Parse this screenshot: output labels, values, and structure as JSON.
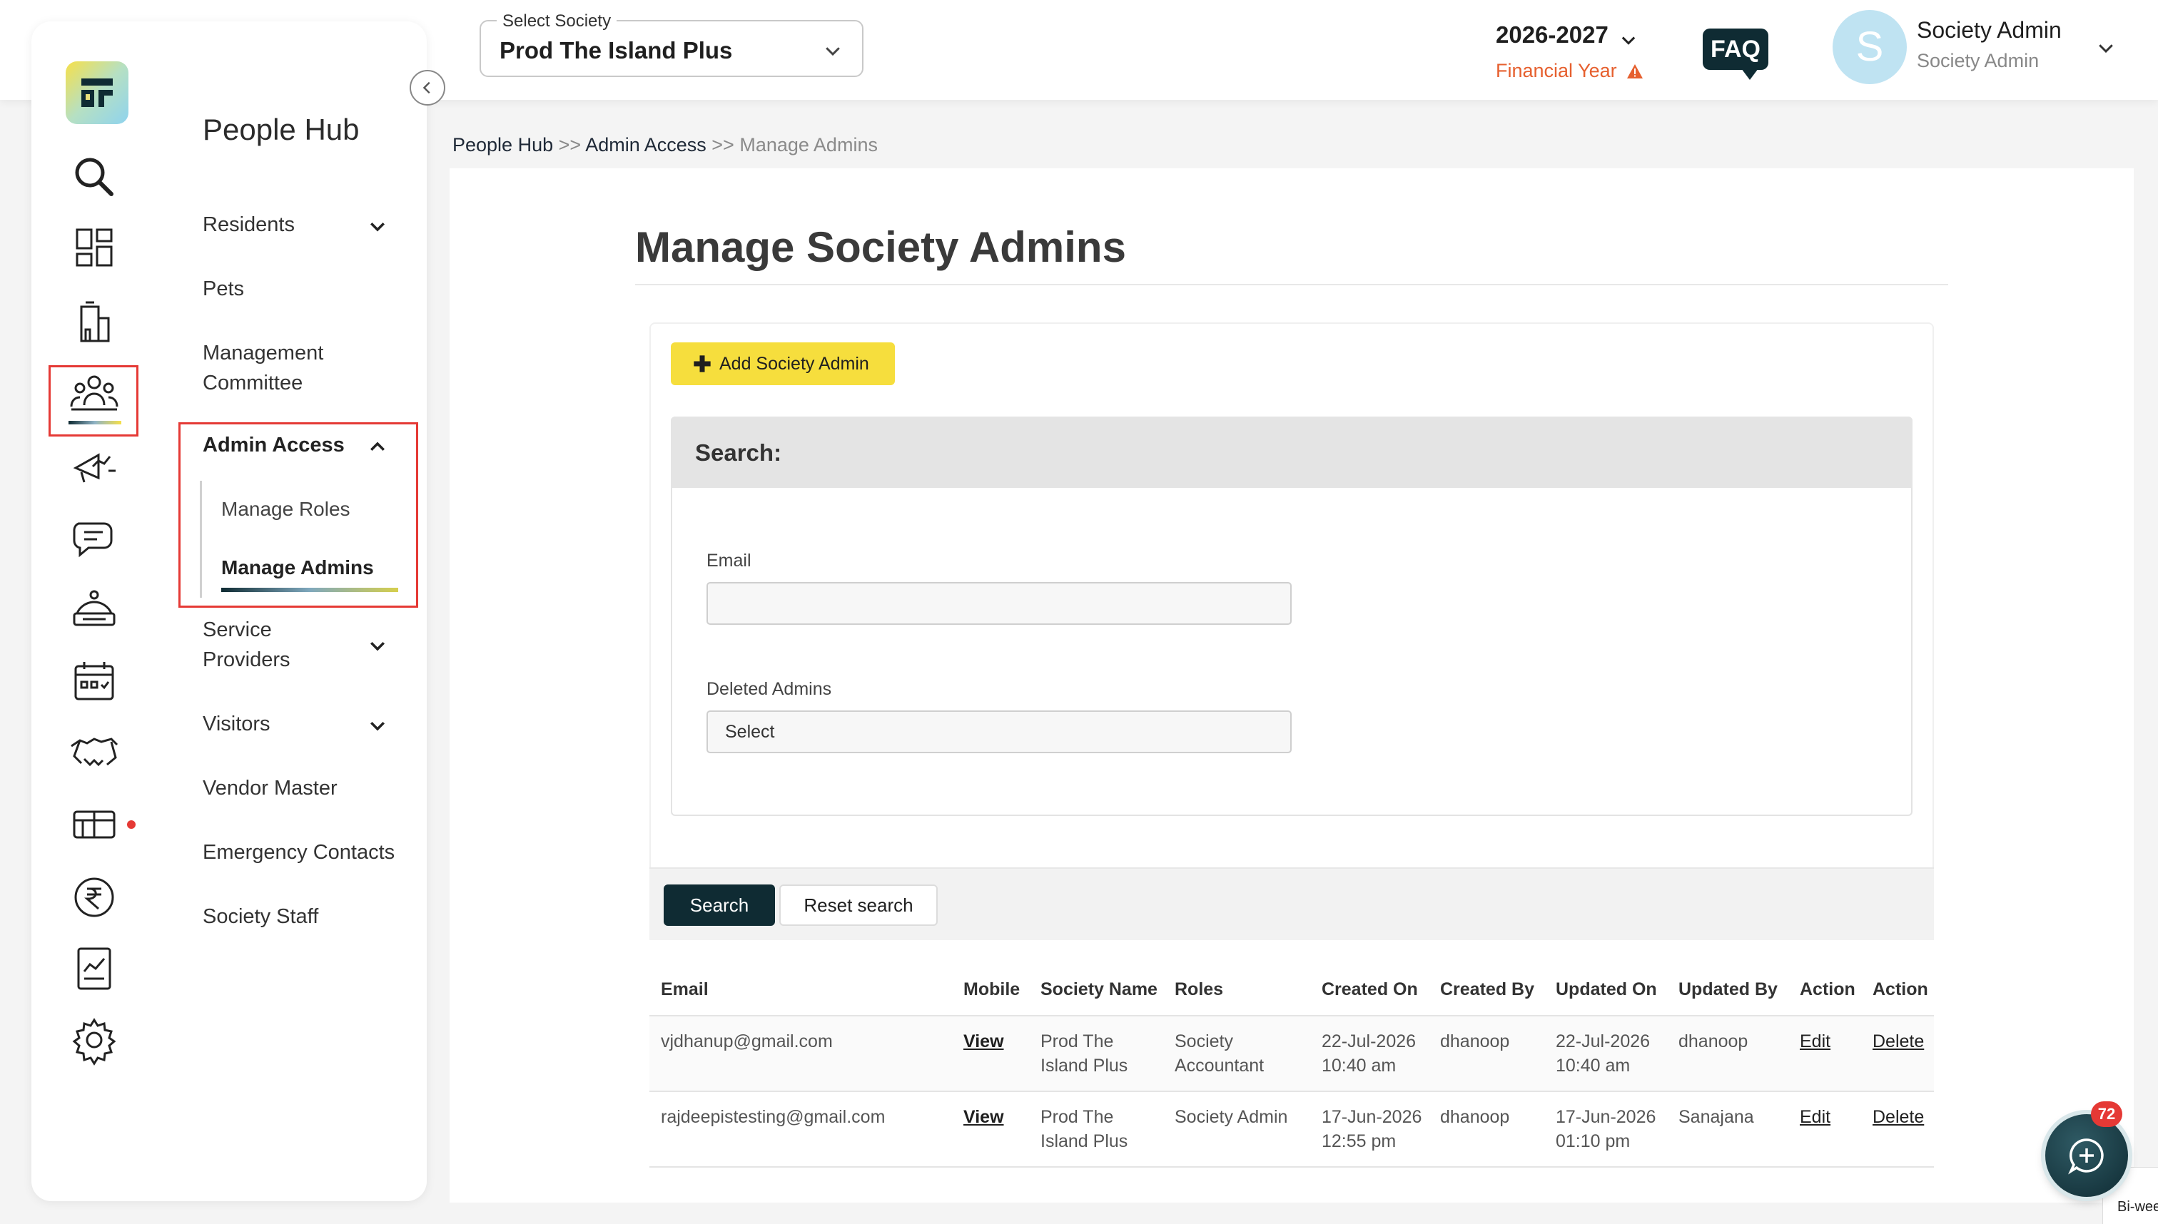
{
  "header": {
    "society_label": "Select Society",
    "society_value": "Prod The Island Plus",
    "year": "2026-2027",
    "financial_year_label": "Financial Year",
    "faq_label": "FAQ",
    "avatar_initial": "S",
    "user_name": "Society Admin",
    "user_role": "Society Admin"
  },
  "sidebar": {
    "title": "People Hub",
    "items": [
      {
        "label": "Residents"
      },
      {
        "label": "Pets"
      },
      {
        "label": "Management\nCommittee"
      },
      {
        "label": "Admin Access"
      },
      {
        "label": "Service\nProviders"
      },
      {
        "label": "Visitors"
      },
      {
        "label": "Vendor Master"
      },
      {
        "label": "Emergency Contacts"
      },
      {
        "label": "Society Staff"
      }
    ],
    "sub_items": [
      {
        "label": "Manage Roles"
      },
      {
        "label": "Manage Admins"
      }
    ]
  },
  "breadcrumb": {
    "items": [
      "People Hub",
      "Admin Access",
      "Manage Admins"
    ],
    "separator": ">>"
  },
  "page": {
    "title": "Manage Society Admins",
    "add_button": "Add Society Admin",
    "search_title": "Search:",
    "email_label": "Email",
    "email_value": "",
    "deleted_label": "Deleted Admins",
    "deleted_value": "Select",
    "search_button": "Search",
    "reset_button": "Reset search"
  },
  "table": {
    "columns": [
      "Email",
      "Mobile",
      "Society Name",
      "Roles",
      "Created On",
      "Created By",
      "Updated On",
      "Updated By",
      "Action",
      "Action"
    ],
    "rows": [
      [
        "vjdhanup@gmail.com",
        "View",
        "Prod The Island Plus",
        "Society Accountant",
        "22-Jul-2026 10:40 am",
        "dhanoop",
        "22-Jul-2026 10:40 am",
        "dhanoop",
        "Edit",
        "Delete"
      ],
      [
        "rajdeepistesting@gmail.com",
        "View",
        "Prod The Island Plus",
        "Society Admin",
        "17-Jun-2026 12:55 pm",
        "dhanoop",
        "17-Jun-2026 01:10 pm",
        "Sanajana",
        "Edit",
        "Delete"
      ]
    ]
  },
  "chat": {
    "badge": "72",
    "peek_text": "Bi-wee"
  },
  "colors": {
    "accent_yellow": "#f6de3d",
    "primary_dark": "#0f2b33",
    "highlight_red": "#e53935",
    "fy_orange": "#e6602f"
  },
  "icons": {
    "rail": [
      "search-icon",
      "dashboard-icon",
      "building-icon",
      "people-icon",
      "megaphone-icon",
      "chat-icon",
      "service-icon",
      "calendar-icon",
      "handshake-icon",
      "store-icon",
      "rupee-icon",
      "report-icon",
      "gear-icon"
    ]
  }
}
